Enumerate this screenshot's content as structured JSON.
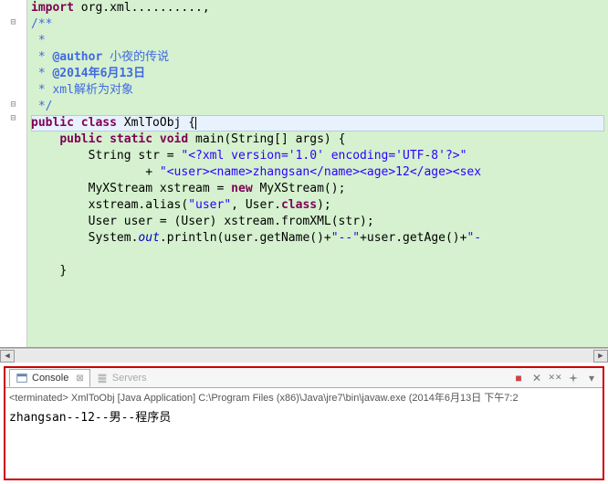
{
  "editor": {
    "lines": [
      {
        "fold": "",
        "segs": [
          {
            "cls": "kw",
            "t": "import"
          },
          {
            "cls": "plain",
            "t": " "
          },
          {
            "cls": "plain",
            "t": "org.xml..........,"
          }
        ]
      },
      {
        "fold": "⊟",
        "segs": [
          {
            "cls": "jd",
            "t": "/**"
          }
        ]
      },
      {
        "fold": "",
        "segs": [
          {
            "cls": "jd-star",
            "t": " * "
          }
        ]
      },
      {
        "fold": "",
        "segs": [
          {
            "cls": "jd-star",
            "t": " * "
          },
          {
            "cls": "jd-tag",
            "t": "@author"
          },
          {
            "cls": "jd",
            "t": " 小夜的传说"
          }
        ]
      },
      {
        "fold": "",
        "segs": [
          {
            "cls": "jd-star",
            "t": " * "
          },
          {
            "cls": "jd-tag",
            "t": "@2014年6月13日"
          }
        ]
      },
      {
        "fold": "",
        "segs": [
          {
            "cls": "jd-star",
            "t": " * "
          },
          {
            "cls": "jd",
            "t": "xml解析为对象"
          }
        ]
      },
      {
        "fold": "",
        "segs": [
          {
            "cls": "jd-star",
            "t": " */"
          }
        ]
      },
      {
        "fold": "⊟",
        "current": true,
        "segs": [
          {
            "cls": "kw",
            "t": "public class"
          },
          {
            "cls": "plain",
            "t": " XmlToObj {"
          },
          {
            "cls": "cursor",
            "t": ""
          }
        ]
      },
      {
        "fold": "⊟",
        "indent": "    ",
        "segs": [
          {
            "cls": "kw",
            "t": "public static void"
          },
          {
            "cls": "plain",
            "t": " main(String[] args) {"
          }
        ]
      },
      {
        "fold": "",
        "indent": "        ",
        "segs": [
          {
            "cls": "plain",
            "t": "String str = "
          },
          {
            "cls": "str",
            "t": "\"<?xml version='1.0' encoding='UTF-8'?>\""
          }
        ]
      },
      {
        "fold": "",
        "indent": "                ",
        "segs": [
          {
            "cls": "plain",
            "t": "+ "
          },
          {
            "cls": "str",
            "t": "\"<user><name>zhangsan</name><age>12</age><sex"
          }
        ]
      },
      {
        "fold": "",
        "indent": "        ",
        "segs": [
          {
            "cls": "plain",
            "t": "MyXStream xstream = "
          },
          {
            "cls": "kw",
            "t": "new"
          },
          {
            "cls": "plain",
            "t": " MyXStream();"
          }
        ]
      },
      {
        "fold": "",
        "indent": "        ",
        "segs": [
          {
            "cls": "plain",
            "t": "xstream.alias("
          },
          {
            "cls": "str",
            "t": "\"user\""
          },
          {
            "cls": "plain",
            "t": ", User."
          },
          {
            "cls": "kw",
            "t": "class"
          },
          {
            "cls": "plain",
            "t": ");"
          }
        ]
      },
      {
        "fold": "",
        "indent": "        ",
        "segs": [
          {
            "cls": "plain",
            "t": "User user = (User) xstream.fromXML(str);"
          }
        ]
      },
      {
        "fold": "",
        "indent": "        ",
        "segs": [
          {
            "cls": "plain",
            "t": "System."
          },
          {
            "cls": "field",
            "t": "out"
          },
          {
            "cls": "plain",
            "t": ".println(user.getName()+"
          },
          {
            "cls": "str",
            "t": "\"--\""
          },
          {
            "cls": "plain",
            "t": "+user.getAge()+"
          },
          {
            "cls": "str",
            "t": "\"-"
          }
        ]
      },
      {
        "fold": "",
        "indent": "",
        "segs": [
          {
            "cls": "plain",
            "t": ""
          }
        ]
      },
      {
        "fold": "",
        "indent": "    ",
        "segs": [
          {
            "cls": "plain",
            "t": "}"
          }
        ]
      }
    ]
  },
  "console": {
    "tab_console": "Console",
    "tab_servers": "Servers",
    "status": "<terminated> XmlToObj [Java Application] C:\\Program Files (x86)\\Java\\jre7\\bin\\javaw.exe (2014年6月13日 下午7:2",
    "output": "zhangsan--12--男--程序员"
  },
  "toolbar": {
    "remove": "✕",
    "remove_all": "✕✕",
    "stop": "■",
    "menu": "▾"
  },
  "scroll": {
    "left_arrow": "◀",
    "right_arrow": "▶"
  }
}
